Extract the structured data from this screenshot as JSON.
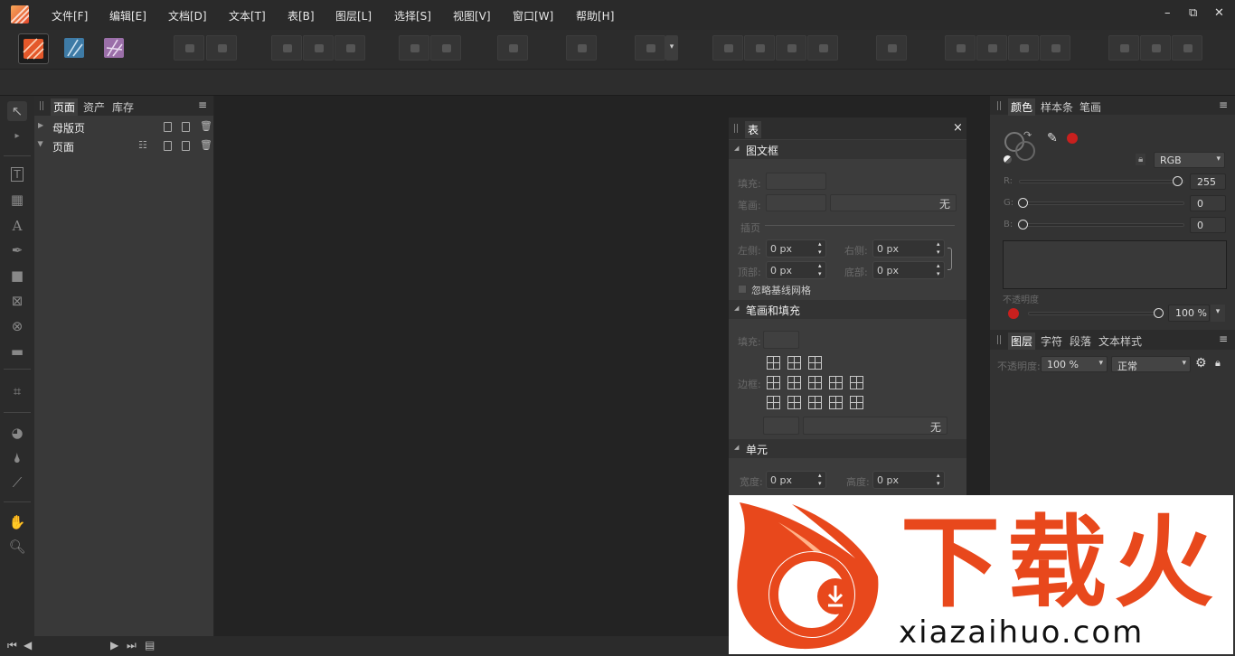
{
  "menubar": {
    "items": [
      "文件[F]",
      "编辑[E]",
      "文档[D]",
      "文本[T]",
      "表[B]",
      "图层[L]",
      "选择[S]",
      "视图[V]",
      "窗口[W]",
      "帮助[H]"
    ],
    "window_controls": [
      "–",
      "⧉",
      "✕"
    ]
  },
  "personas": [
    "publisher",
    "designer",
    "photo"
  ],
  "left_panel": {
    "tabs": [
      "页面",
      "资产",
      "库存"
    ],
    "menu_icon": "≡",
    "rows": [
      {
        "label": "母版页",
        "expanded": false
      },
      {
        "label": "页面",
        "expanded": true
      }
    ]
  },
  "table_panel": {
    "title": "表",
    "close": "×",
    "sections": {
      "text_frame": "图文框",
      "stroke_fill": "笔画和填充",
      "cell": "单元"
    },
    "fill_label": "填充:",
    "stroke_label": "笔画:",
    "stroke_value": "无",
    "inset_label": "插页",
    "left_label": "左侧:",
    "right_label": "右侧:",
    "top_label": "顶部:",
    "bottom_label": "底部:",
    "left_value": "0 px",
    "right_value": "0 px",
    "top_value": "0 px",
    "bottom_value": "0 px",
    "ignore_baseline": "忽略基线网格",
    "fill2_label": "填充:",
    "border_label": "边框:",
    "border_value": "无",
    "width_label": "宽度:",
    "width_value": "0 px",
    "height_label": "高度:",
    "height_value": "0 px"
  },
  "color_panel": {
    "tabs": [
      "颜色",
      "样本条",
      "笔画"
    ],
    "menu_icon": "≡",
    "model": "RGB",
    "channels": [
      {
        "label": "R:",
        "value": "255",
        "level": 1.0
      },
      {
        "label": "G:",
        "value": "0",
        "level": 0.0
      },
      {
        "label": "B:",
        "value": "0",
        "level": 0.0
      }
    ],
    "opacity_label": "不透明度",
    "opacity_value": "100 %",
    "swatch_color": "#c8201e"
  },
  "layers_panel": {
    "tabs": [
      "图层",
      "字符",
      "段落",
      "文本样式"
    ],
    "menu_icon": "≡",
    "opacity_label": "不透明度:",
    "opacity_value": "100 %",
    "blend_mode": "正常"
  },
  "watermark": {
    "title": "下载火",
    "url": "xiazaihuo.com",
    "accent": "#e8481c"
  }
}
